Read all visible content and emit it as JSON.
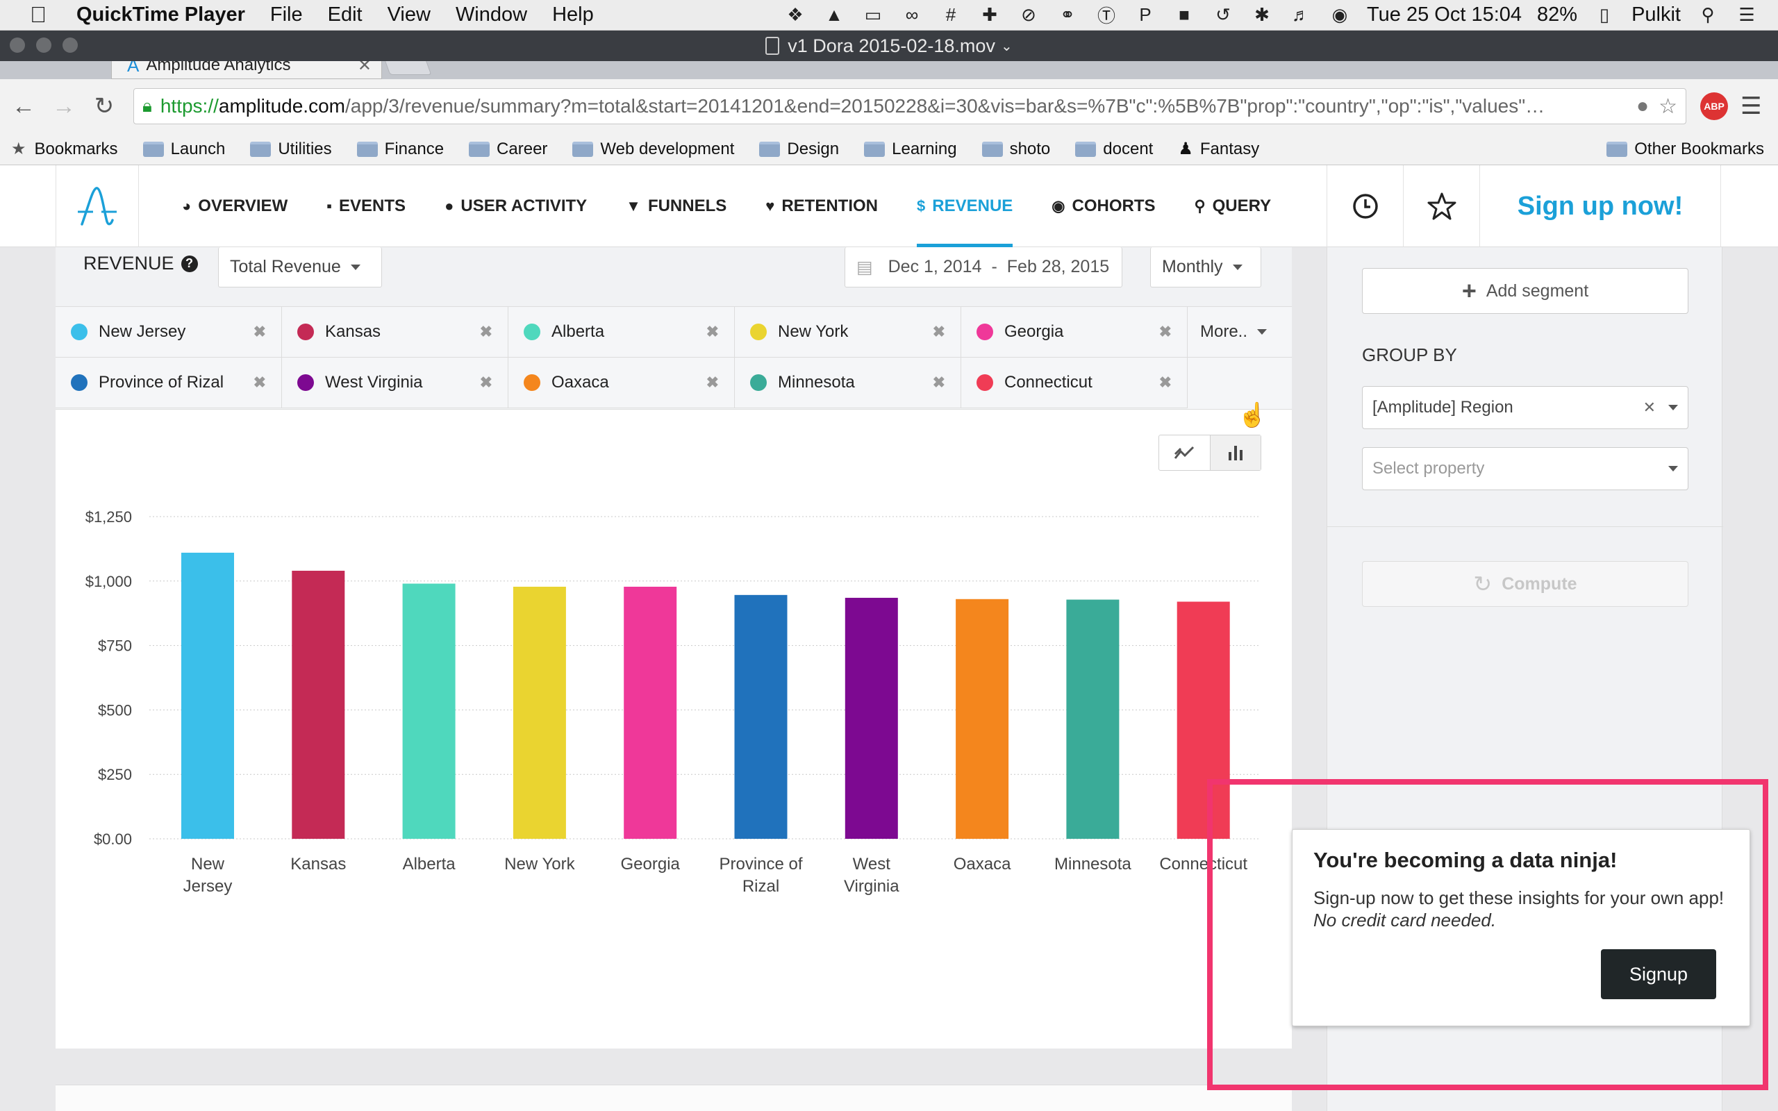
{
  "menubar": {
    "app_name": "QuickTime Player",
    "menus": [
      "File",
      "Edit",
      "View",
      "Window",
      "Help"
    ],
    "datetime": "Tue 25 Oct  15:04",
    "battery": "82%",
    "user": "Pulkit"
  },
  "qt_window": {
    "title": "v1 Dora 2015-02-18.mov"
  },
  "browser": {
    "tab_title": "Amplitude Analytics",
    "url_scheme": "https://",
    "url_host": "amplitude.com",
    "url_path": "/app/3/revenue/summary?m=total&start=20141201&end=20150228&i=30&vis=bar&s=%7B\"c\":%5B%7B\"prop\":\"country\",\"op\":\"is\",\"values\"…",
    "abp_label": "ABP",
    "bookmarks": [
      "Bookmarks",
      "Launch",
      "Utilities",
      "Finance",
      "Career",
      "Web development",
      "Design",
      "Learning",
      "shoto",
      "docent",
      "Fantasy"
    ],
    "other_bookmarks": "Other Bookmarks"
  },
  "nav": {
    "items": [
      {
        "label": "OVERVIEW",
        "icon": "dashboard-icon"
      },
      {
        "label": "EVENTS",
        "icon": "signal-icon"
      },
      {
        "label": "USER ACTIVITY",
        "icon": "user-icon"
      },
      {
        "label": "FUNNELS",
        "icon": "funnel-icon"
      },
      {
        "label": "RETENTION",
        "icon": "heart-icon"
      },
      {
        "label": "REVENUE",
        "icon": "dollar-icon"
      },
      {
        "label": "COHORTS",
        "icon": "users-icon"
      },
      {
        "label": "QUERY",
        "icon": "search-icon"
      }
    ],
    "active": "REVENUE",
    "signup_label": "Sign up now!"
  },
  "revenue": {
    "label": "REVENUE",
    "metric": "Total Revenue",
    "date_start": "Dec 1, 2014",
    "date_sep": "-",
    "date_end": "Feb 28, 2015",
    "interval": "Monthly",
    "more_label": "More.."
  },
  "segments": [
    {
      "name": "New Jersey",
      "color": "#3bbfea"
    },
    {
      "name": "Kansas",
      "color": "#c42a55"
    },
    {
      "name": "Alberta",
      "color": "#4fd8bd"
    },
    {
      "name": "New York",
      "color": "#ead430"
    },
    {
      "name": "Georgia",
      "color": "#ef3899"
    },
    {
      "name": "Province of Rizal",
      "color": "#2072bc"
    },
    {
      "name": "West Virginia",
      "color": "#7d0991"
    },
    {
      "name": "Oaxaca",
      "color": "#f4861d"
    },
    {
      "name": "Minnesota",
      "color": "#3aab98"
    },
    {
      "name": "Connecticut",
      "color": "#f03c55"
    }
  ],
  "chart_data": {
    "type": "bar",
    "categories": [
      "New Jersey",
      "Kansas",
      "Alberta",
      "New York",
      "Georgia",
      "Province of Rizal",
      "West Virginia",
      "Oaxaca",
      "Minnesota",
      "Connecticut"
    ],
    "category_lines": [
      [
        "New",
        "Jersey"
      ],
      [
        "Kansas"
      ],
      [
        "Alberta"
      ],
      [
        "New York"
      ],
      [
        "Georgia"
      ],
      [
        "Province of",
        "Rizal"
      ],
      [
        "West",
        "Virginia"
      ],
      [
        "Oaxaca"
      ],
      [
        "Minnesota"
      ],
      [
        "Connecticut"
      ]
    ],
    "values": [
      1110,
      1040,
      990,
      978,
      978,
      946,
      935,
      930,
      928,
      920
    ],
    "colors": [
      "#3bbfea",
      "#c42a55",
      "#4fd8bd",
      "#ead430",
      "#ef3899",
      "#2072bc",
      "#7d0991",
      "#f4861d",
      "#3aab98",
      "#f03c55"
    ],
    "yticks": [
      0,
      250,
      500,
      750,
      1000,
      1250
    ],
    "ytick_labels": [
      "$0.00",
      "$250",
      "$500",
      "$750",
      "$1,000",
      "$1,250"
    ],
    "ylim": [
      0,
      1250
    ],
    "grid": true
  },
  "sidebar": {
    "add_segment": "Add segment",
    "group_by": "GROUP BY",
    "group_value": "[Amplitude] Region",
    "property_placeholder": "Select property",
    "compute": "Compute"
  },
  "popup": {
    "title": "You're becoming a data ninja!",
    "body": "Sign-up now to get these insights for your own app!",
    "body_em": "No credit card needed.",
    "button": "Signup"
  }
}
